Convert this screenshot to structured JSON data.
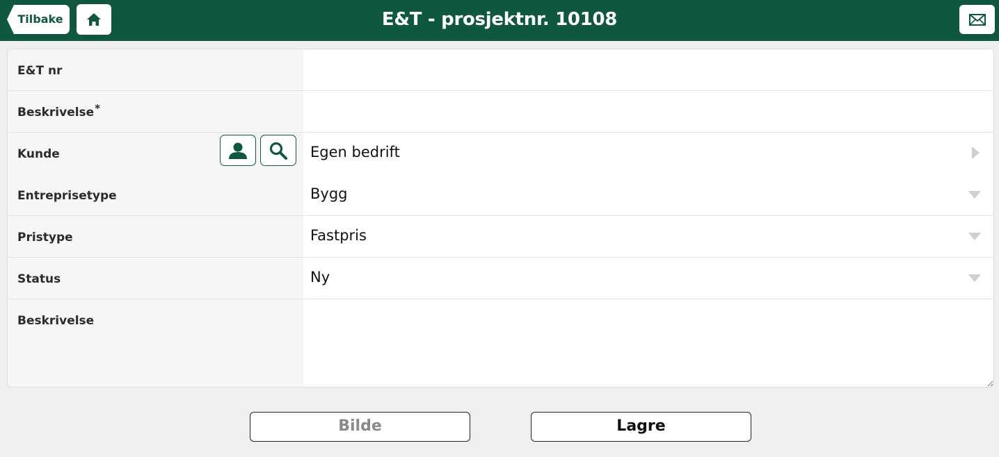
{
  "header": {
    "title": "E&T - prosjektnr. 10108",
    "back_label": "Tilbake",
    "home_icon": "home-icon",
    "mail_icon": "envelope-icon",
    "bg_color": "#10573f"
  },
  "form": {
    "et_nr": {
      "label": "E&T nr",
      "value": ""
    },
    "beskrivelse_short": {
      "label": "Beskrivelse",
      "required_mark": "*",
      "value": ""
    },
    "kunde": {
      "label": "Kunde",
      "value": "Egen bedrift",
      "icons": [
        "person-icon",
        "search-icon"
      ]
    },
    "entreprisetype": {
      "label": "Entreprisetype",
      "value": "Bygg"
    },
    "pristype": {
      "label": "Pristype",
      "value": "Fastpris"
    },
    "status": {
      "label": "Status",
      "value": "Ny"
    },
    "beskrivelse_long": {
      "label": "Beskrivelse",
      "value": ""
    }
  },
  "actions": {
    "bilde_label": "Bilde",
    "lagre_label": "Lagre"
  }
}
